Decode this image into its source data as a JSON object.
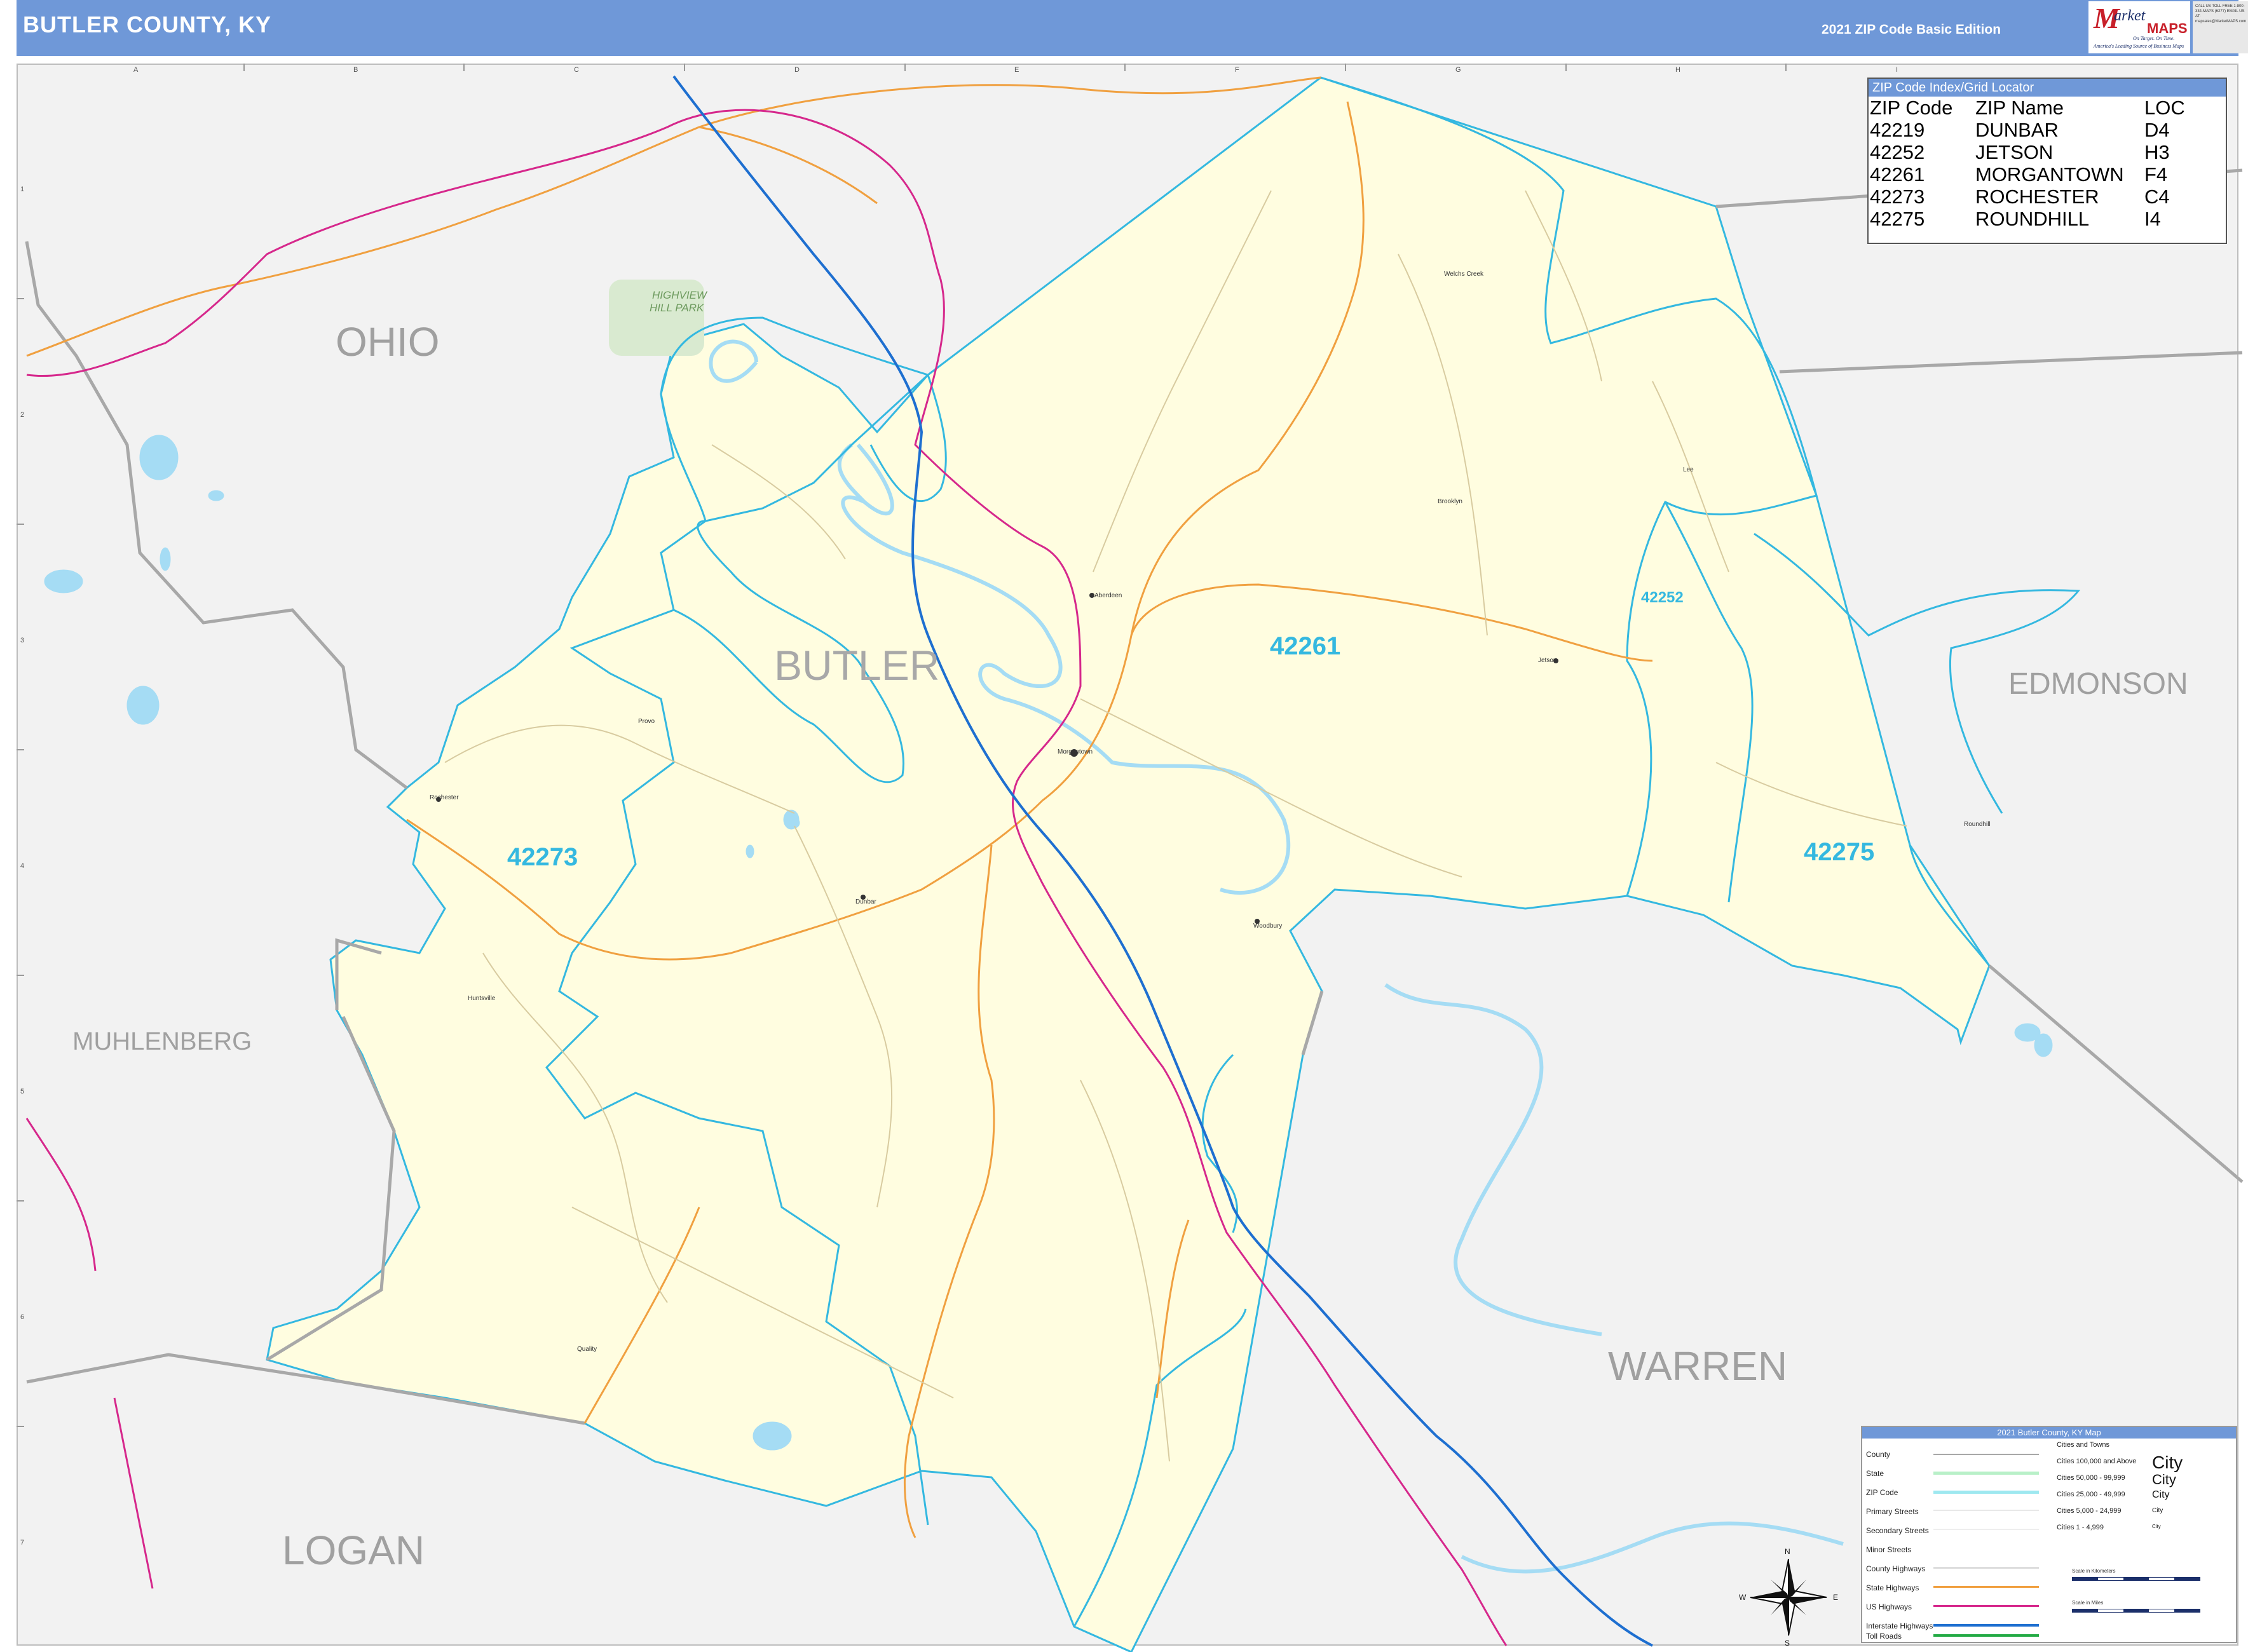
{
  "header": {
    "title": "BUTLER COUNTY, KY",
    "edition": "2021 ZIP Code Basic Edition",
    "logo_m": "M",
    "logo_market": "arket",
    "logo_maps": "MAPS",
    "logo_tagline": "On Target. On Time.",
    "logo_tagline2": "America's Leading Source of Business Maps",
    "contact": "CALL US TOLL FREE 1-800-334-MAPS (6277) EMAIL US AT: mapsales@MarketMAPS.com"
  },
  "grid": {
    "letters": [
      "A",
      "B",
      "C",
      "D",
      "E",
      "F",
      "G",
      "H",
      "I"
    ],
    "numbers": [
      "1",
      "2",
      "3",
      "4",
      "5",
      "6",
      "7"
    ]
  },
  "counties": {
    "butler": "BUTLER",
    "ohio": "OHIO",
    "muhlenberg": "MUHLENBERG",
    "logan": "LOGAN",
    "warren": "WARREN",
    "edmonson": "EDMONSON"
  },
  "zip_labels": {
    "z42261": "42261",
    "z42273": "42273",
    "z42275": "42275",
    "z42252": "42252"
  },
  "park": {
    "name_line1": "HIGHVIEW",
    "name_line2": "HILL PARK"
  },
  "towns": {
    "rochester": "Rochester",
    "morgantown": "Morgantown",
    "dunbar": "Dunbar",
    "jetson": "Jetson",
    "roundhill": "Roundhill",
    "woodbury": "Woodbury",
    "aberdeen": "Aberdeen",
    "quality": "Quality",
    "huntsville": "Huntsville",
    "brooklyn": "Brooklyn",
    "lee": "Lee",
    "provo": "Provo",
    "welchs_creek": "Welchs Creek"
  },
  "zip_index": {
    "title": "ZIP Code Index/Grid Locator",
    "headers": [
      "ZIP Code",
      "ZIP Name",
      "LOC"
    ],
    "rows": [
      [
        "42219",
        "DUNBAR",
        "D4"
      ],
      [
        "42252",
        "JETSON",
        "H3"
      ],
      [
        "42261",
        "MORGANTOWN",
        "F4"
      ],
      [
        "42273",
        "ROCHESTER",
        "C4"
      ],
      [
        "42275",
        "ROUNDHILL",
        "I4"
      ]
    ]
  },
  "legend": {
    "title": "2021 Butler County, KY Map",
    "items": [
      "County",
      "State",
      "ZIP Code",
      "Primary Streets",
      "Secondary Streets",
      "Minor Streets",
      "County Highways",
      "State Highways",
      "US Highways",
      "Interstate Highways",
      "Toll Roads"
    ],
    "cities_header": "Cities and Towns",
    "cities": [
      "Cities 100,000 and Above",
      "Cities 50,000 - 99,999",
      "Cities 25,000 - 49,999",
      "Cities 5,000 - 24,999",
      "Cities 1 - 4,999"
    ],
    "city_sample": "City",
    "scale_km": "Scale in Kilometers",
    "scale_mi": "Scale in Miles"
  },
  "compass": {
    "n": "N",
    "s": "S",
    "e": "E",
    "w": "W"
  },
  "colors": {
    "header": "#6f98d8",
    "county_fill": "#fffde0",
    "outside_fill": "#f2f2f2",
    "zip_boundary": "#34b8e0",
    "county_boundary": "#a8a8a8",
    "water": "#a5dcf4",
    "state_highway": "#f0a040",
    "us_highway": "#d6288c",
    "interstate": "#1e6fd0",
    "park": "#d9ead0"
  }
}
